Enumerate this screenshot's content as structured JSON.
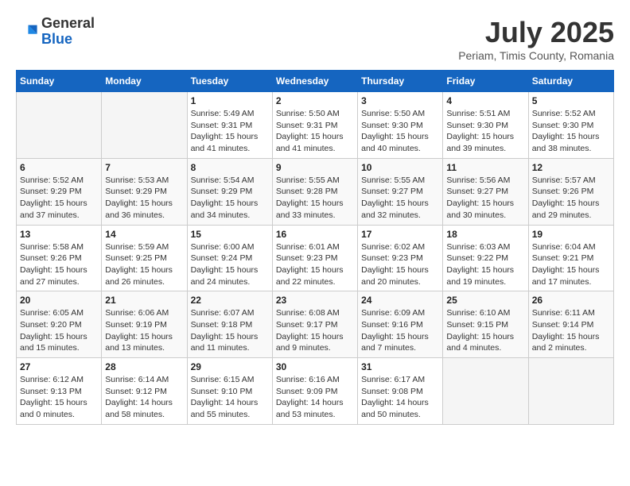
{
  "header": {
    "logo": {
      "general": "General",
      "blue": "Blue"
    },
    "title": "July 2025",
    "subtitle": "Periam, Timis County, Romania"
  },
  "days_of_week": [
    "Sunday",
    "Monday",
    "Tuesday",
    "Wednesday",
    "Thursday",
    "Friday",
    "Saturday"
  ],
  "weeks": [
    [
      {
        "day": "",
        "sunrise": "",
        "sunset": "",
        "daylight": ""
      },
      {
        "day": "",
        "sunrise": "",
        "sunset": "",
        "daylight": ""
      },
      {
        "day": "1",
        "sunrise": "Sunrise: 5:49 AM",
        "sunset": "Sunset: 9:31 PM",
        "daylight": "Daylight: 15 hours and 41 minutes."
      },
      {
        "day": "2",
        "sunrise": "Sunrise: 5:50 AM",
        "sunset": "Sunset: 9:31 PM",
        "daylight": "Daylight: 15 hours and 41 minutes."
      },
      {
        "day": "3",
        "sunrise": "Sunrise: 5:50 AM",
        "sunset": "Sunset: 9:30 PM",
        "daylight": "Daylight: 15 hours and 40 minutes."
      },
      {
        "day": "4",
        "sunrise": "Sunrise: 5:51 AM",
        "sunset": "Sunset: 9:30 PM",
        "daylight": "Daylight: 15 hours and 39 minutes."
      },
      {
        "day": "5",
        "sunrise": "Sunrise: 5:52 AM",
        "sunset": "Sunset: 9:30 PM",
        "daylight": "Daylight: 15 hours and 38 minutes."
      }
    ],
    [
      {
        "day": "6",
        "sunrise": "Sunrise: 5:52 AM",
        "sunset": "Sunset: 9:29 PM",
        "daylight": "Daylight: 15 hours and 37 minutes."
      },
      {
        "day": "7",
        "sunrise": "Sunrise: 5:53 AM",
        "sunset": "Sunset: 9:29 PM",
        "daylight": "Daylight: 15 hours and 36 minutes."
      },
      {
        "day": "8",
        "sunrise": "Sunrise: 5:54 AM",
        "sunset": "Sunset: 9:29 PM",
        "daylight": "Daylight: 15 hours and 34 minutes."
      },
      {
        "day": "9",
        "sunrise": "Sunrise: 5:55 AM",
        "sunset": "Sunset: 9:28 PM",
        "daylight": "Daylight: 15 hours and 33 minutes."
      },
      {
        "day": "10",
        "sunrise": "Sunrise: 5:55 AM",
        "sunset": "Sunset: 9:27 PM",
        "daylight": "Daylight: 15 hours and 32 minutes."
      },
      {
        "day": "11",
        "sunrise": "Sunrise: 5:56 AM",
        "sunset": "Sunset: 9:27 PM",
        "daylight": "Daylight: 15 hours and 30 minutes."
      },
      {
        "day": "12",
        "sunrise": "Sunrise: 5:57 AM",
        "sunset": "Sunset: 9:26 PM",
        "daylight": "Daylight: 15 hours and 29 minutes."
      }
    ],
    [
      {
        "day": "13",
        "sunrise": "Sunrise: 5:58 AM",
        "sunset": "Sunset: 9:26 PM",
        "daylight": "Daylight: 15 hours and 27 minutes."
      },
      {
        "day": "14",
        "sunrise": "Sunrise: 5:59 AM",
        "sunset": "Sunset: 9:25 PM",
        "daylight": "Daylight: 15 hours and 26 minutes."
      },
      {
        "day": "15",
        "sunrise": "Sunrise: 6:00 AM",
        "sunset": "Sunset: 9:24 PM",
        "daylight": "Daylight: 15 hours and 24 minutes."
      },
      {
        "day": "16",
        "sunrise": "Sunrise: 6:01 AM",
        "sunset": "Sunset: 9:23 PM",
        "daylight": "Daylight: 15 hours and 22 minutes."
      },
      {
        "day": "17",
        "sunrise": "Sunrise: 6:02 AM",
        "sunset": "Sunset: 9:23 PM",
        "daylight": "Daylight: 15 hours and 20 minutes."
      },
      {
        "day": "18",
        "sunrise": "Sunrise: 6:03 AM",
        "sunset": "Sunset: 9:22 PM",
        "daylight": "Daylight: 15 hours and 19 minutes."
      },
      {
        "day": "19",
        "sunrise": "Sunrise: 6:04 AM",
        "sunset": "Sunset: 9:21 PM",
        "daylight": "Daylight: 15 hours and 17 minutes."
      }
    ],
    [
      {
        "day": "20",
        "sunrise": "Sunrise: 6:05 AM",
        "sunset": "Sunset: 9:20 PM",
        "daylight": "Daylight: 15 hours and 15 minutes."
      },
      {
        "day": "21",
        "sunrise": "Sunrise: 6:06 AM",
        "sunset": "Sunset: 9:19 PM",
        "daylight": "Daylight: 15 hours and 13 minutes."
      },
      {
        "day": "22",
        "sunrise": "Sunrise: 6:07 AM",
        "sunset": "Sunset: 9:18 PM",
        "daylight": "Daylight: 15 hours and 11 minutes."
      },
      {
        "day": "23",
        "sunrise": "Sunrise: 6:08 AM",
        "sunset": "Sunset: 9:17 PM",
        "daylight": "Daylight: 15 hours and 9 minutes."
      },
      {
        "day": "24",
        "sunrise": "Sunrise: 6:09 AM",
        "sunset": "Sunset: 9:16 PM",
        "daylight": "Daylight: 15 hours and 7 minutes."
      },
      {
        "day": "25",
        "sunrise": "Sunrise: 6:10 AM",
        "sunset": "Sunset: 9:15 PM",
        "daylight": "Daylight: 15 hours and 4 minutes."
      },
      {
        "day": "26",
        "sunrise": "Sunrise: 6:11 AM",
        "sunset": "Sunset: 9:14 PM",
        "daylight": "Daylight: 15 hours and 2 minutes."
      }
    ],
    [
      {
        "day": "27",
        "sunrise": "Sunrise: 6:12 AM",
        "sunset": "Sunset: 9:13 PM",
        "daylight": "Daylight: 15 hours and 0 minutes."
      },
      {
        "day": "28",
        "sunrise": "Sunrise: 6:14 AM",
        "sunset": "Sunset: 9:12 PM",
        "daylight": "Daylight: 14 hours and 58 minutes."
      },
      {
        "day": "29",
        "sunrise": "Sunrise: 6:15 AM",
        "sunset": "Sunset: 9:10 PM",
        "daylight": "Daylight: 14 hours and 55 minutes."
      },
      {
        "day": "30",
        "sunrise": "Sunrise: 6:16 AM",
        "sunset": "Sunset: 9:09 PM",
        "daylight": "Daylight: 14 hours and 53 minutes."
      },
      {
        "day": "31",
        "sunrise": "Sunrise: 6:17 AM",
        "sunset": "Sunset: 9:08 PM",
        "daylight": "Daylight: 14 hours and 50 minutes."
      },
      {
        "day": "",
        "sunrise": "",
        "sunset": "",
        "daylight": ""
      },
      {
        "day": "",
        "sunrise": "",
        "sunset": "",
        "daylight": ""
      }
    ]
  ]
}
